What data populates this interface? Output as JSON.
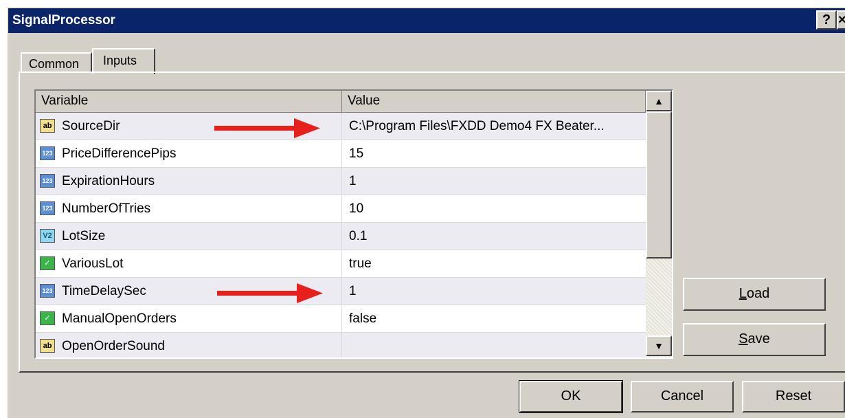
{
  "window": {
    "title": "SignalProcessor",
    "help_label": "?",
    "close_label": "×"
  },
  "tabs": [
    {
      "label": "Common",
      "active": false
    },
    {
      "label": "Inputs",
      "active": true
    }
  ],
  "grid": {
    "headers": {
      "variable": "Variable",
      "value": "Value"
    },
    "rows": [
      {
        "icon": "ab",
        "variable": "SourceDir",
        "value": "C:\\Program Files\\FXDD Demo4 FX Beater..."
      },
      {
        "icon": "123",
        "variable": "PriceDifferencePips",
        "value": "15"
      },
      {
        "icon": "123",
        "variable": "ExpirationHours",
        "value": "1"
      },
      {
        "icon": "123",
        "variable": "NumberOfTries",
        "value": "10"
      },
      {
        "icon": "V2",
        "variable": "LotSize",
        "value": "0.1"
      },
      {
        "icon": "bool",
        "variable": "VariousLot",
        "value": "true"
      },
      {
        "icon": "123",
        "variable": "TimeDelaySec",
        "value": "1"
      },
      {
        "icon": "bool",
        "variable": "ManualOpenOrders",
        "value": "false"
      },
      {
        "icon": "ab",
        "variable": "OpenOrderSound",
        "value": ""
      }
    ]
  },
  "buttons": {
    "load_key": "L",
    "load_rest": "oad",
    "save_key": "S",
    "save_rest": "ave",
    "ok": "OK",
    "cancel": "Cancel",
    "reset": "Reset"
  },
  "colors": {
    "title_bar": "#0a246a",
    "dialog_bg": "#d4d0c8",
    "arrow": "#e8201c"
  }
}
